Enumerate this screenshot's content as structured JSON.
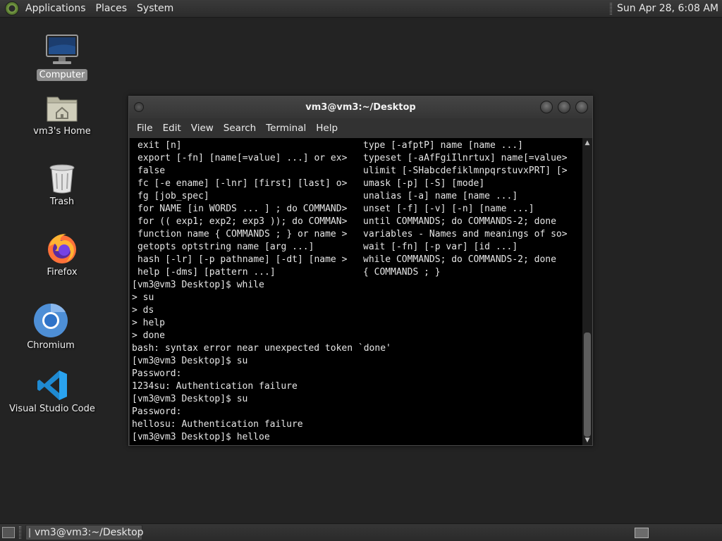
{
  "top_panel": {
    "menus": [
      "Applications",
      "Places",
      "System"
    ],
    "clock": "Sun Apr 28,  6:08 AM"
  },
  "desktop_icons": [
    {
      "label": "Computer",
      "icon": "computer-icon"
    },
    {
      "label": "vm3's Home",
      "icon": "home-folder-icon"
    },
    {
      "label": "Trash",
      "icon": "trash-icon"
    },
    {
      "label": "Firefox",
      "icon": "firefox-icon"
    },
    {
      "label": "Chromium",
      "icon": "chromium-icon"
    },
    {
      "label": "Visual Studio Code",
      "icon": "vscode-icon"
    }
  ],
  "window": {
    "title": "vm3@vm3:~/Desktop",
    "menu": [
      "File",
      "Edit",
      "View",
      "Search",
      "Terminal",
      "Help"
    ]
  },
  "terminal": {
    "help_rows": [
      {
        "left": "exit [n]",
        "right": "type [-afptP] name [name ...]"
      },
      {
        "left": "export [-fn] [name[=value] ...] or ex>",
        "right": "typeset [-aAfFgiIlnrtux] name[=value>"
      },
      {
        "left": "false",
        "right": "ulimit [-SHabcdefiklmnpqrstuvxPRT] [>"
      },
      {
        "left": "fc [-e ename] [-lnr] [first] [last] o>",
        "right": "umask [-p] [-S] [mode]"
      },
      {
        "left": "fg [job_spec]",
        "right": "unalias [-a] name [name ...]"
      },
      {
        "left": "for NAME [in WORDS ... ] ; do COMMAND>",
        "right": "unset [-f] [-v] [-n] [name ...]"
      },
      {
        "left": "for (( exp1; exp2; exp3 )); do COMMAN>",
        "right": "until COMMANDS; do COMMANDS-2; done"
      },
      {
        "left": "function name { COMMANDS ; } or name >",
        "right": "variables - Names and meanings of so>"
      },
      {
        "left": "getopts optstring name [arg ...]",
        "right": "wait [-fn] [-p var] [id ...]"
      },
      {
        "left": "hash [-lr] [-p pathname] [-dt] [name >",
        "right": "while COMMANDS; do COMMANDS-2; done"
      },
      {
        "left": "help [-dms] [pattern ...]",
        "right": "{ COMMANDS ; }"
      }
    ],
    "lines": [
      "[vm3@vm3 Desktop]$ while",
      "> su",
      "> ds",
      "> help",
      "> done",
      "bash: syntax error near unexpected token `done'",
      "[vm3@vm3 Desktop]$ su",
      "Password:",
      "1234su: Authentication failure",
      "[vm3@vm3 Desktop]$ su",
      "Password:",
      "hellosu: Authentication failure",
      "[vm3@vm3 Desktop]$ helloe"
    ]
  },
  "taskbar": {
    "task_label": "vm3@vm3:~/Desktop"
  }
}
